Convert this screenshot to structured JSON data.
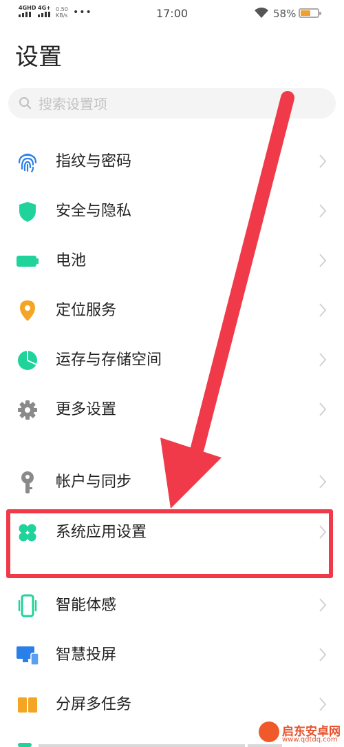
{
  "status_bar": {
    "network1": "4GHD",
    "network2": "4G+",
    "speed_value": "0.50",
    "speed_unit": "KB/s",
    "more": "•••",
    "time": "17:00",
    "battery_percent": "58%",
    "battery_level": 0.58
  },
  "page": {
    "title": "设置"
  },
  "search": {
    "placeholder": "搜索设置项",
    "value": ""
  },
  "settings_items": [
    {
      "label": "指纹与密码",
      "icon": "fingerprint-icon",
      "color": "#2b7fe8"
    },
    {
      "label": "安全与隐私",
      "icon": "shield-icon",
      "color": "#1fd39a"
    },
    {
      "label": "电池",
      "icon": "battery-icon",
      "color": "#1fd39a"
    },
    {
      "label": "定位服务",
      "icon": "location-pin-icon",
      "color": "#f5a524"
    },
    {
      "label": "运存与存储空间",
      "icon": "pie-chart-icon",
      "color": "#1fd39a"
    },
    {
      "label": "更多设置",
      "icon": "gear-icon",
      "color": "#8a8a8a"
    },
    {
      "label": "帐户与同步",
      "icon": "key-icon",
      "color": "#8a8a8a"
    },
    {
      "label": "系统应用设置",
      "icon": "four-leaf-icon",
      "color": "#1fd39a"
    },
    {
      "label": "智能体感",
      "icon": "phone-motion-icon",
      "color": "#1fd39a"
    },
    {
      "label": "智慧投屏",
      "icon": "screen-cast-icon",
      "color": "#2b7fe8"
    },
    {
      "label": "分屏多任务",
      "icon": "split-screen-icon",
      "color": "#f5a524"
    }
  ],
  "annotation": {
    "color": "#f03a4a"
  },
  "watermark": {
    "name": "启东安卓网",
    "url": "www.qdtdq.com"
  }
}
